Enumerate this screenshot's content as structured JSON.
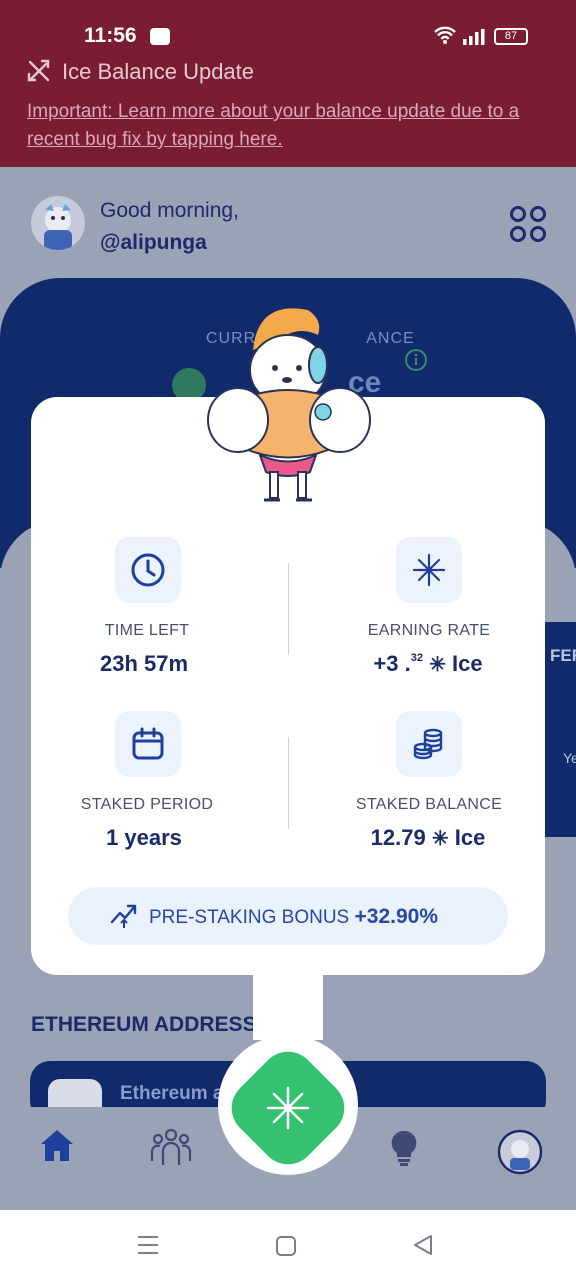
{
  "status_bar": {
    "time": "11:56",
    "battery": "87"
  },
  "banner": {
    "title": "Ice Balance Update",
    "link_text": "Important: Learn more about your balance update due to a recent bug fix by tapping here."
  },
  "header": {
    "greeting": "Good morning,",
    "username": "@alipunga"
  },
  "balance_card": {
    "label_visible": "CURR",
    "label_tail": "ANCE",
    "ice_visible": "ce"
  },
  "modal": {
    "time_left": {
      "label": "TIME LEFT",
      "value": "23h 57m"
    },
    "earning_rate": {
      "label": "EARNING RATE",
      "value_main": "+3 .",
      "value_sup": "32",
      "unit": "Ice"
    },
    "staked_period": {
      "label": "STAKED PERIOD",
      "value": "1 years"
    },
    "staked_balance": {
      "label": "STAKED BALANCE",
      "value": "12.79",
      "unit": "Ice"
    },
    "bonus": {
      "label": "PRE-STAKING BONUS",
      "value": "+32.90%"
    }
  },
  "background": {
    "side_text": "FER",
    "side_text2": "Ye",
    "eth_title": "ETHEREUM ADDRESS",
    "eth_card": "Ethereum a"
  },
  "colors": {
    "banner": "#7a1d33",
    "navy": "#1b2a6b",
    "accent_green": "#35c16f"
  }
}
